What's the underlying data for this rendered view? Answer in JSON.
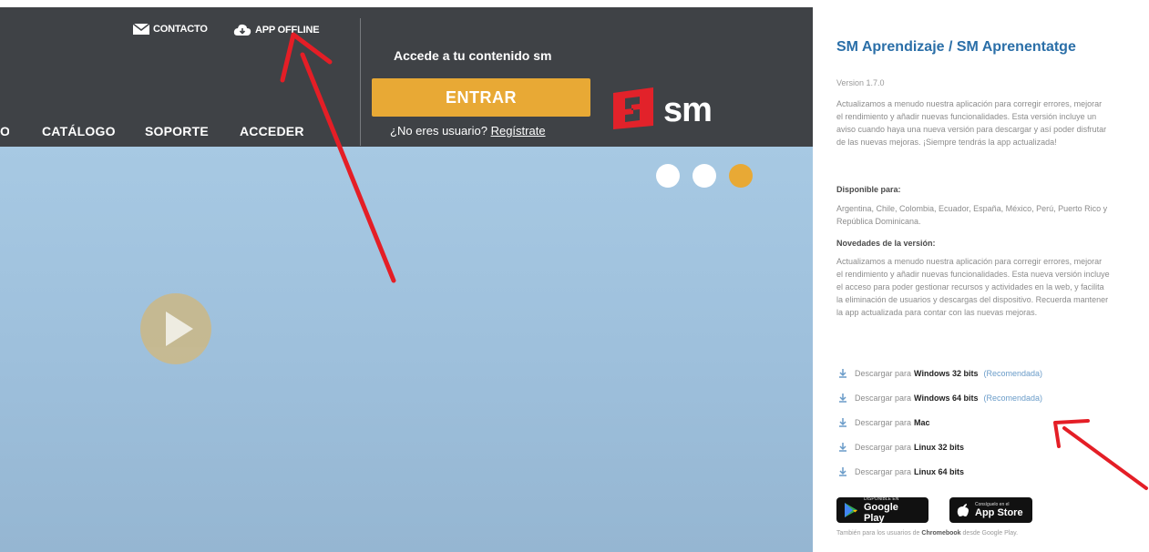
{
  "header": {
    "contact_label": "CONTACTO",
    "app_offline_label": "APP OFFLINE",
    "menu": [
      "CATÁLOGO",
      "SOPORTE",
      "ACCEDER"
    ],
    "access_title": "Accede a tu contenido sm",
    "enter_button": "ENTRAR",
    "register_prefix": "¿No eres usuario?",
    "register_link": "Regístrate",
    "logo_text": "sm"
  },
  "colors": {
    "header_bg": "#3f4246",
    "accent_orange": "#e8a935",
    "logo_red": "#e2222a",
    "hero_blue": "#a7c9e3",
    "title_blue": "#2b6fa8",
    "annotation_red": "#e41e26"
  },
  "carousel": {
    "slides": 3,
    "active_index": 2
  },
  "panel": {
    "title": "SM Aprendizaje / SM Aprenentatge",
    "version": "Version 1.7.0",
    "description": "Actualizamos a menudo nuestra aplicación para corregir errores, mejorar el rendimiento y añadir nuevas funcionalidades. Esta versión incluye un aviso cuando haya una nueva versión para descargar y así poder disfrutar de las nuevas mejoras. ¡Siempre tendrás la app actualizada!",
    "available_heading": "Disponible para:",
    "available_countries": "Argentina, Chile, Colombia, Ecuador, España, México, Perú, Puerto Rico y República Dominicana.",
    "news_heading": "Novedades de la versión:",
    "news_text": "Actualizamos a menudo nuestra aplicación para corregir errores, mejorar el rendimiento y añadir nuevas funcionalidades. Esta nueva versión incluye el acceso para poder gestionar recursos y actividades en la web, y facilita la eliminación de usuarios y descargas del dispositivo. Recuerda mantener la app actualizada para contar con las nuevas mejoras.",
    "downloads": [
      {
        "prefix": "Descargar para",
        "platform": "Windows 32 bits",
        "note": "(Recomendada)"
      },
      {
        "prefix": "Descargar para",
        "platform": "Windows 64 bits",
        "note": "(Recomendada)"
      },
      {
        "prefix": "Descargar para",
        "platform": "Mac",
        "note": ""
      },
      {
        "prefix": "Descargar para",
        "platform": "Linux 32 bits",
        "note": ""
      },
      {
        "prefix": "Descargar para",
        "platform": "Linux 64 bits",
        "note": ""
      }
    ],
    "google_play_small": "DISPONIBLE EN",
    "google_play_big": "Google Play",
    "app_store_small": "Consíguelo en el",
    "app_store_big": "App Store",
    "footer_prefix": "También para los usuarios de",
    "footer_bold": "Chromebook",
    "footer_suffix": "desde Google Play."
  }
}
